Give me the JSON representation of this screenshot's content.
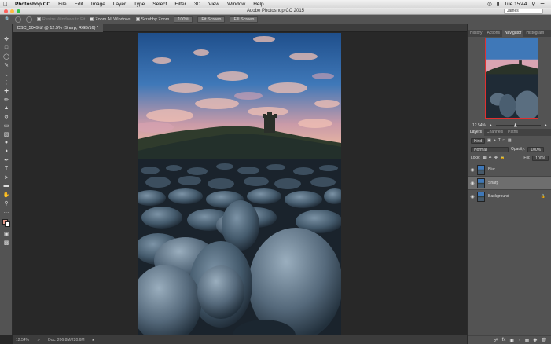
{
  "menubar": {
    "app": "Photoshop CC",
    "items": [
      "File",
      "Edit",
      "Image",
      "Layer",
      "Type",
      "Select",
      "Filter",
      "3D",
      "View",
      "Window",
      "Help"
    ],
    "clock": "Tue 15:44"
  },
  "window": {
    "title": "Adobe Photoshop CC 2015",
    "user": "James"
  },
  "options": {
    "resize_label": "Resize Windows to Fit",
    "zoom_all_label": "Zoom All Windows",
    "scrubby_label": "Scrubby Zoom",
    "btn_100": "100%",
    "btn_fit": "Fit Screen",
    "btn_fill": "Fill Screen"
  },
  "doc_tab": "DSC_5049.tif @ 12.5% (Sharp, RGB/16) *",
  "panels": {
    "top_tabs": [
      "History",
      "Actions",
      "Navigator",
      "Histogram"
    ],
    "nav_zoom": "12.54%",
    "layer_tabs": [
      "Layers",
      "Channels",
      "Paths"
    ],
    "kind": "Kind",
    "blend_mode": "Normal",
    "opacity_label": "Opacity:",
    "opacity_value": "100%",
    "lock_label": "Lock:",
    "fill_label": "Fill:",
    "fill_value": "100%",
    "layers": [
      {
        "name": "Blur"
      },
      {
        "name": "Sharp"
      },
      {
        "name": "Background"
      }
    ]
  },
  "status": {
    "zoom": "12.54%",
    "doc": "Doc: 206.8M/220.6M"
  },
  "colors": {
    "accent_red": "#e03030",
    "panel_bg": "#535353"
  }
}
